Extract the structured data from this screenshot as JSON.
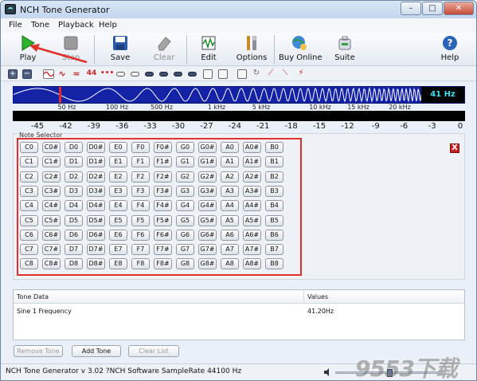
{
  "window": {
    "title": "NCH Tone Generator",
    "controls": [
      "–",
      "□",
      "✕"
    ]
  },
  "menu": [
    "File",
    "Tone",
    "Playback",
    "Help"
  ],
  "toolbar": {
    "play": "Play",
    "stop": "Stop",
    "save": "Save",
    "clear": "Clear",
    "edit": "Edit",
    "options": "Options",
    "buy_online": "Buy Online",
    "suite": "Suite",
    "help": "Help"
  },
  "frequency": {
    "readout": "41 Hz",
    "scale": [
      "50 Hz",
      "100 Hz",
      "500 Hz",
      "1 kHz",
      "5 kHz",
      "10 kHz",
      "15 kHz",
      "20 kHz"
    ]
  },
  "db_scale": [
    "-45",
    "-42",
    "-39",
    "-36",
    "-33",
    "-30",
    "-27",
    "-24",
    "-21",
    "-18",
    "-15",
    "-12",
    "-9",
    "-6",
    "-3",
    "0"
  ],
  "note_selector": {
    "legend": "Note Selector",
    "close": "X",
    "rows": [
      [
        "C0",
        "C0#",
        "D0",
        "D0#",
        "E0",
        "F0",
        "F0#",
        "G0",
        "G0#",
        "A0",
        "A0#",
        "B0"
      ],
      [
        "C1",
        "C1#",
        "D1",
        "D1#",
        "E1",
        "F1",
        "F1#",
        "G1",
        "G1#",
        "A1",
        "A1#",
        "B1"
      ],
      [
        "C2",
        "C2#",
        "D2",
        "D2#",
        "E2",
        "F2",
        "F2#",
        "G2",
        "G2#",
        "A2",
        "A2#",
        "B2"
      ],
      [
        "C3",
        "C3#",
        "D3",
        "D3#",
        "E3",
        "F3",
        "F3#",
        "G3",
        "G3#",
        "A3",
        "A3#",
        "B3"
      ],
      [
        "C4",
        "C4#",
        "D4",
        "D4#",
        "E4",
        "F4",
        "F4#",
        "G4",
        "G4#",
        "A4",
        "A4#",
        "B4"
      ],
      [
        "C5",
        "C5#",
        "D5",
        "D5#",
        "E5",
        "F5",
        "F5#",
        "G5",
        "G5#",
        "A5",
        "A5#",
        "B5"
      ],
      [
        "C6",
        "C6#",
        "D6",
        "D6#",
        "E6",
        "F6",
        "F6#",
        "G6",
        "G6#",
        "A6",
        "A6#",
        "B6"
      ],
      [
        "C7",
        "C7#",
        "D7",
        "D7#",
        "E7",
        "F7",
        "F7#",
        "G7",
        "G7#",
        "A7",
        "A7#",
        "B7"
      ],
      [
        "C8",
        "C8#",
        "D8",
        "D8#",
        "E8",
        "F8",
        "F8#",
        "G8",
        "G8#",
        "A8",
        "A8#",
        "B8"
      ]
    ]
  },
  "tone_table": {
    "headers": [
      "Tone Data",
      "Values"
    ],
    "rows": [
      [
        "Sine 1 Frequency",
        "41.20Hz"
      ]
    ]
  },
  "buttons": {
    "remove_tone": "Remove Tone",
    "add_tone": "Add Tone",
    "clear_list": "Clear List"
  },
  "status": {
    "text": "NCH Tone Generator v 3.02 ?NCH Software SampleRate 44100 Hz",
    "watermark": "9553下载"
  },
  "colors": {
    "accent_red": "#e2302b",
    "freq_bar_blue": "#1422a6",
    "readout_cyan": "#3be0f0"
  }
}
